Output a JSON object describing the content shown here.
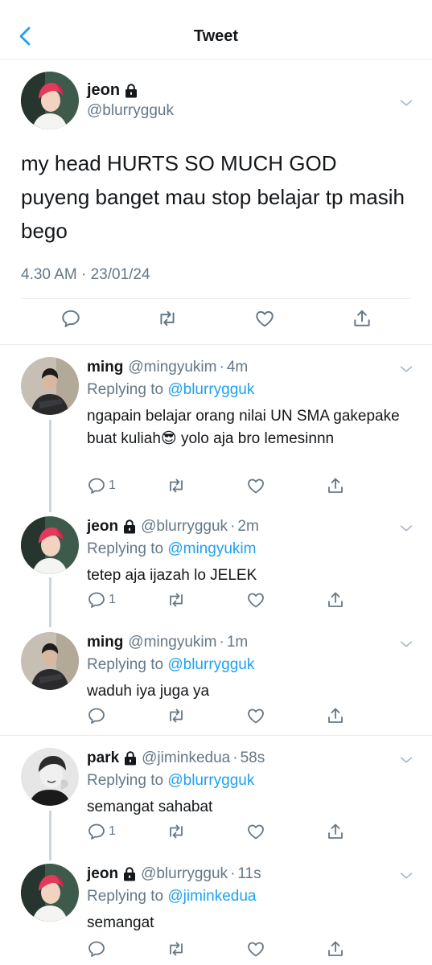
{
  "nav": {
    "title": "Tweet"
  },
  "main_tweet": {
    "name": "jeon",
    "handle": "@blurrygguk",
    "text": "my head HURTS SO MUCH GOD puyeng banget mau stop belajar tp masih bego",
    "timestamp": "4.30 AM · 23/01/24"
  },
  "replies": [
    {
      "name": "ming",
      "handle": "@mingyukim",
      "dot": "·",
      "time": "4m",
      "replying_prefix": "Replying to",
      "replying_to": "@blurrygguk",
      "text": "ngapain belajar orang nilai UN SMA gakepake buat kuliah😎 yolo aja bro lemesinnn",
      "reply_count": "1",
      "locked": false
    },
    {
      "name": "jeon",
      "handle": "@blurrygguk",
      "dot": "·",
      "time": "2m",
      "replying_prefix": "Replying to",
      "replying_to": "@mingyukim",
      "text": "tetep aja ijazah lo JELEK",
      "reply_count": "1",
      "locked": true
    },
    {
      "name": "ming",
      "handle": "@mingyukim",
      "dot": "·",
      "time": "1m",
      "replying_prefix": "Replying to",
      "replying_to": "@blurrygguk",
      "text": "waduh iya juga ya",
      "reply_count": "",
      "locked": false
    },
    {
      "name": "park",
      "handle": "@jiminkedua",
      "dot": "·",
      "time": "58s",
      "replying_prefix": "Replying to",
      "replying_to": "@blurrygguk",
      "text": "semangat sahabat",
      "reply_count": "1",
      "locked": true
    },
    {
      "name": "jeon",
      "handle": "@blurrygguk",
      "dot": "·",
      "time": "11s",
      "replying_prefix": "Replying to",
      "replying_to": "@jiminkedua",
      "text": "semangat",
      "reply_count": "",
      "locked": true
    }
  ],
  "colors": {
    "accent": "#1da1f2",
    "secondary_text": "#657786",
    "divider": "#e6ecf0",
    "thread_line": "#ccd6dd"
  },
  "icons": [
    "back-chevron-icon",
    "lock-icon",
    "chevron-down-icon",
    "reply-icon",
    "retweet-icon",
    "like-icon",
    "share-icon"
  ]
}
